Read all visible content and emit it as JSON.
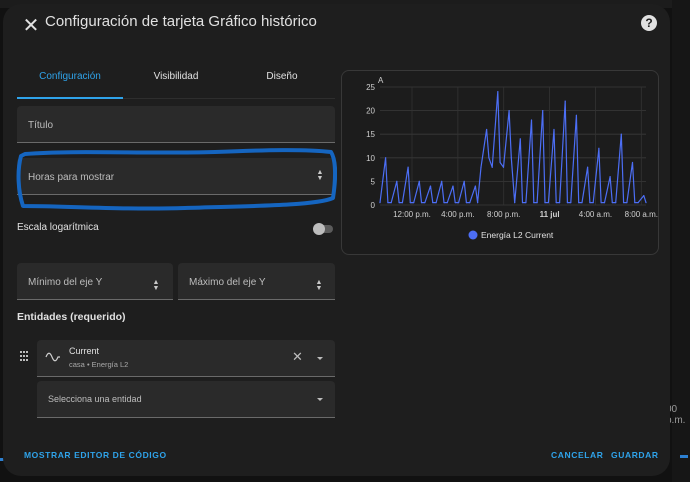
{
  "dialog": {
    "title": "Configuración de tarjeta Gráfico histórico",
    "close_icon": "close-icon",
    "help_icon": "help-circle-icon",
    "help_glyph": "?"
  },
  "tabs": [
    {
      "label": "Configuración",
      "active": true
    },
    {
      "label": "Visibilidad",
      "active": false
    },
    {
      "label": "Diseño",
      "active": false
    }
  ],
  "form": {
    "title_label": "Título",
    "hours_label": "Horas para mostrar",
    "log_scale_label": "Escala logarítmica",
    "log_scale_on": false,
    "y_min_label": "Mínimo del eje Y",
    "y_max_label": "Máximo del eje Y",
    "entities_heading": "Entidades (requerido)"
  },
  "entities": [
    {
      "name": "Current",
      "area": "casa",
      "device": "Energía L2",
      "icon": "sine-wave-icon"
    }
  ],
  "entity_picker_placeholder": "Selecciona una entidad",
  "footer": {
    "code_editor_label": "MOSTRAR EDITOR DE CÓDIGO",
    "cancel_label": "CANCELAR",
    "save_label": "GUARDAR"
  },
  "background": {
    "partial_text": "00 p.m."
  },
  "colors": {
    "accent": "#2fa3ea",
    "line": "#4c6ef5",
    "annotation": "#1565c0"
  },
  "chart_data": {
    "type": "line",
    "ylabel": "A",
    "ylim": [
      0,
      25
    ],
    "yticks": [
      0,
      5,
      10,
      15,
      20,
      25
    ],
    "xticks": [
      "12:00 p.m.",
      "4:00 p.m.",
      "8:00 p.m.",
      "11 jul",
      "4:00 a.m.",
      "8:00 a.m."
    ],
    "x": [
      0,
      0.5,
      0.7,
      1,
      1.5,
      1.7,
      2,
      2.5,
      2.7,
      3,
      3.5,
      3.7,
      4,
      4.5,
      4.7,
      5,
      5.5,
      5.7,
      6,
      6.5,
      6.7,
      7,
      7.5,
      7.7,
      8,
      8.5,
      8.7,
      9,
      9.5,
      9.7,
      10,
      10.5,
      10.7,
      11,
      11.5,
      11.7,
      12,
      12.5,
      12.7,
      13,
      13.5,
      13.7,
      14,
      14.5,
      14.7,
      15,
      15.5,
      15.7,
      16,
      16.5,
      16.7,
      17,
      17.5,
      17.7,
      18,
      18.5,
      18.7,
      19,
      19.5,
      19.7,
      20,
      20.5,
      20.7,
      21,
      21.5,
      21.7,
      22,
      22.5,
      22.7,
      23,
      23.5,
      23.7
    ],
    "series": [
      {
        "name": "Energía L2 Current",
        "values": [
          0.5,
          10,
          0.5,
          0.5,
          5,
          0.5,
          0.5,
          8,
          0.5,
          0.5,
          5,
          0.5,
          0.5,
          4,
          0.5,
          0.5,
          5,
          0.5,
          0.5,
          4,
          0.5,
          0.5,
          5,
          0.5,
          0.5,
          4,
          0.5,
          8,
          16,
          10,
          8,
          24,
          9,
          8,
          20,
          10,
          0.5,
          14,
          0.5,
          0.5,
          18,
          0.5,
          0.5,
          20,
          0.5,
          0.5,
          16,
          0.5,
          0.5,
          22,
          0.5,
          0.5,
          19,
          0.5,
          0.5,
          8,
          0.5,
          0.5,
          12,
          0.5,
          0.5,
          6,
          0.5,
          0.5,
          15,
          0.5,
          0.5,
          9,
          0.5,
          0.5,
          2,
          0.5
        ]
      }
    ],
    "legend": "bottom",
    "grid": true
  }
}
